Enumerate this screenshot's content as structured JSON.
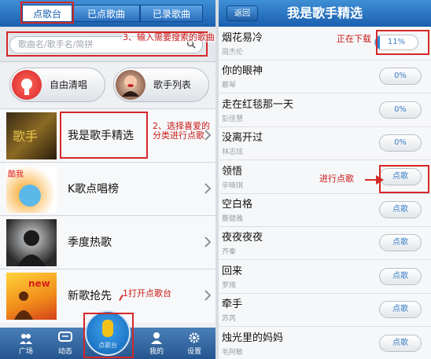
{
  "left": {
    "tabs": [
      "点歌台",
      "已点歌曲",
      "已录歌曲"
    ],
    "search_placeholder": "歌曲名/歌手名/简拼",
    "quick": [
      "自由清唱",
      "歌手列表"
    ],
    "categories": [
      "我是歌手精选",
      "K歌点唱榜",
      "季度热歌",
      "新歌抢先"
    ],
    "nav": [
      "广场",
      "动态",
      "点歌台",
      "我的",
      "设置"
    ],
    "annotations": {
      "a3": "3、输入需要搜索的歌曲",
      "a2": "2、选择喜爱的分类进行点歌",
      "a1": "1打开点歌台"
    }
  },
  "right": {
    "back": "返回",
    "title": "我是歌手精选",
    "songs": [
      {
        "name": "烟花易冷",
        "singer": "周杰伦",
        "btn": "11%"
      },
      {
        "name": "你的眼神",
        "singer": "蔡琴",
        "btn": "0%"
      },
      {
        "name": "走在红毯那一天",
        "singer": "彭佳慧",
        "btn": "0%"
      },
      {
        "name": "没离开过",
        "singer": "林志炫",
        "btn": "0%"
      },
      {
        "name": "领悟",
        "singer": "辛晓琪",
        "btn": "点歌"
      },
      {
        "name": "空白格",
        "singer": "蔡健雅",
        "btn": "点歌"
      },
      {
        "name": "夜夜夜夜",
        "singer": "齐秦",
        "btn": "点歌"
      },
      {
        "name": "回来",
        "singer": "罗琦",
        "btn": "点歌"
      },
      {
        "name": "牵手",
        "singer": "苏芮",
        "btn": "点歌"
      },
      {
        "name": "烛光里的妈妈",
        "singer": "毛阿敏",
        "btn": "点歌"
      }
    ],
    "download_progress": 0.11,
    "annotations": {
      "downloading": "正在下载",
      "order": "进行点歌"
    }
  }
}
